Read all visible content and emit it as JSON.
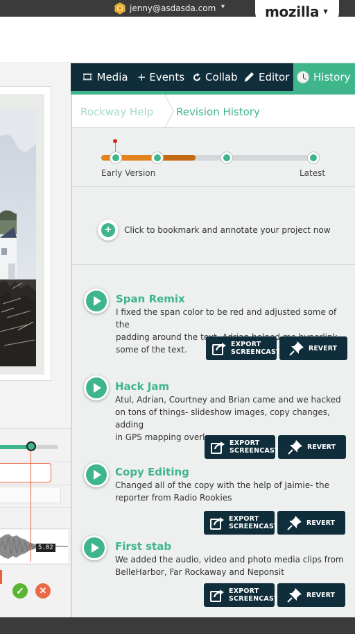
{
  "topbar": {
    "email": "jenny@asdasda.com",
    "brand": "mozilla"
  },
  "nav": {
    "items": [
      {
        "label": "Media",
        "icon": "film-icon"
      },
      {
        "label": "+ Events",
        "icon": "plus-icon"
      },
      {
        "label": "Collab",
        "icon": "share-icon"
      },
      {
        "label": "Editor",
        "icon": "pencil-icon"
      },
      {
        "label": "History",
        "icon": "clock-icon",
        "active": true
      }
    ]
  },
  "breadcrumb": {
    "parent": "Rockway Help",
    "current": "Revision History"
  },
  "version_slider": {
    "start_label": "Early Version",
    "end_label": "Latest",
    "stops": 4,
    "selected_progress": 0.44
  },
  "bookmark": {
    "text": "Click to bookmark and annotate your project now"
  },
  "timeline": {
    "time_badge": "5.02"
  },
  "revisions": [
    {
      "title": "Span Remix",
      "desc_lines": [
        "I fixed the span color to be red and adjusted some of the",
        "padding around the text.  Adrian helped me hyperlink",
        "some of the text."
      ]
    },
    {
      "title": "Hack Jam",
      "desc_lines": [
        "Atul, Adrian, Courtney and Brian came and we hacked",
        "on tons of things- slideshow images, copy changes, adding",
        "in GPS mapping overlay."
      ]
    },
    {
      "title": "Copy Editing",
      "desc_lines": [
        "Changed all of the copy with the help of Jaimie- the",
        "reporter from Radio Rookies"
      ]
    },
    {
      "title": "First stab",
      "desc_lines": [
        "We added the audio, video and photo media clips from",
        "BelleHarbor, Far Rockaway and Neponsit"
      ]
    }
  ],
  "buttons": {
    "export_line1": "EXPORT",
    "export_line2": "SCREENCAST",
    "revert": "REVERT"
  },
  "colors": {
    "accent": "#3fb58b",
    "nav_bg": "#102d3b",
    "slider_fill": "#e3831e",
    "playhead": "#e8603a"
  }
}
